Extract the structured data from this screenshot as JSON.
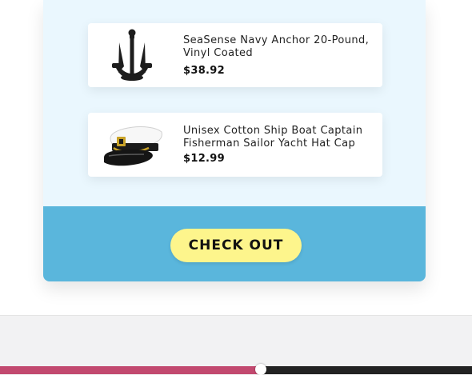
{
  "cart": {
    "items": [
      {
        "name": "SeaSense Navy Anchor 20-Pound, Vinyl Coated",
        "price": "$38.92",
        "icon": "anchor-icon"
      },
      {
        "name": "Unisex Cotton Ship Boat Captain Fisherman Sailor Yacht Hat Cap",
        "price": "$12.99",
        "icon": "captain-hat-icon"
      }
    ],
    "checkout_label": "CHECK OUT"
  },
  "playback": {
    "progress_fraction": 0.553
  }
}
